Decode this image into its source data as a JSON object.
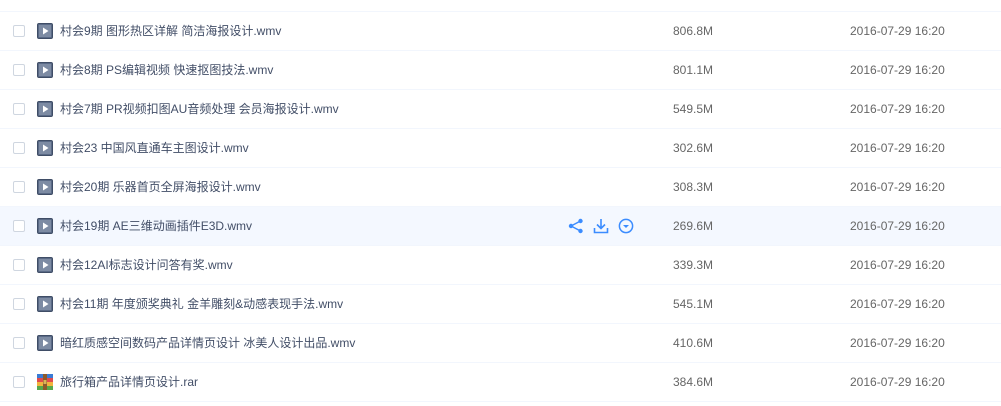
{
  "files": [
    {
      "name": "村会9期 图形热区详解 简洁海报设计.wmv",
      "size": "806.8M",
      "date": "2016-07-29 16:20",
      "type": "video-file-icon"
    },
    {
      "name": "村会8期 PS编辑视频 快速抠图技法.wmv",
      "size": "801.1M",
      "date": "2016-07-29 16:20",
      "type": "video-file-icon"
    },
    {
      "name": "村会7期 PR视频扣图AU音频处理 会员海报设计.wmv",
      "size": "549.5M",
      "date": "2016-07-29 16:20",
      "type": "video-file-icon"
    },
    {
      "name": "村会23 中国风直通车主图设计.wmv",
      "size": "302.6M",
      "date": "2016-07-29 16:20",
      "type": "video-file-icon"
    },
    {
      "name": "村会20期 乐器首页全屏海报设计.wmv",
      "size": "308.3M",
      "date": "2016-07-29 16:20",
      "type": "video-file-icon"
    },
    {
      "name": "村会19期 AE三维动画插件E3D.wmv",
      "size": "269.6M",
      "date": "2016-07-29 16:20",
      "type": "video-file-icon"
    },
    {
      "name": "村会12AI标志设计问答有奖.wmv",
      "size": "339.3M",
      "date": "2016-07-29 16:20",
      "type": "video-file-icon"
    },
    {
      "name": "村会11期 年度颁奖典礼 金羊雕刻&动感表现手法.wmv",
      "size": "545.1M",
      "date": "2016-07-29 16:20",
      "type": "video-file-icon"
    },
    {
      "name": "暗红质感空间数码产品详情页设计 冰美人设计出品.wmv",
      "size": "410.6M",
      "date": "2016-07-29 16:20",
      "type": "video-file-icon"
    },
    {
      "name": "旅行箱产品详情页设计.rar",
      "size": "384.6M",
      "date": "2016-07-29 16:20",
      "type": "archive-file-icon"
    }
  ],
  "row_actions": {
    "share_icon": "share-icon",
    "download_icon": "download-icon",
    "more_icon": "chevron-down-circle-icon"
  },
  "colors": {
    "accent": "#3b8cff",
    "row_hover": "#f4f8ff",
    "text": "#424e67"
  }
}
